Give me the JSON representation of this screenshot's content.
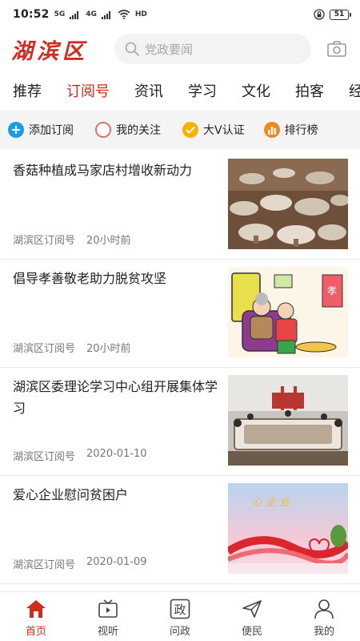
{
  "status_bar": {
    "time": "10:52",
    "signal_1": "5G",
    "signal_2": "4G",
    "network": "HD",
    "battery": "51"
  },
  "header": {
    "logo": "湖滨区",
    "search_placeholder": "党政要闻"
  },
  "tabs": [
    "推荐",
    "订阅号",
    "资讯",
    "学习",
    "文化",
    "拍客",
    "经济"
  ],
  "active_tab": "订阅号",
  "quick_entries": [
    {
      "label": "添加订阅",
      "icon": "plus-icon",
      "color": "#1e9be0"
    },
    {
      "label": "我的关注",
      "icon": "circle-icon",
      "color": "#e8706b"
    },
    {
      "label": "大V认证",
      "icon": "check-badge-icon",
      "color": "#f5b400"
    },
    {
      "label": "排行榜",
      "icon": "bar-chart-icon",
      "color": "#f08a1c"
    }
  ],
  "news": [
    {
      "title": "香菇种植成马家店村增收新动力",
      "source": "湖滨区订阅号",
      "time": "20小时前",
      "image": "mushroom-photo"
    },
    {
      "title": "倡导孝善敬老助力脱贫攻坚",
      "source": "湖滨区订阅号",
      "time": "20小时前",
      "image": "filial-piety-illustration"
    },
    {
      "title": "湖滨区委理论学习中心组开展集体学习",
      "source": "湖滨区订阅号",
      "time": "2020-01-10",
      "image": "meeting-photo"
    },
    {
      "title": "爱心企业慰问贫困户",
      "source": "湖滨区订阅号",
      "time": "2020-01-09",
      "image": "charity-graphic"
    }
  ],
  "thumb_texts": {
    "poster_word": "孝",
    "charity_word": "心 企 业"
  },
  "bottom_nav": [
    {
      "label": "首页",
      "icon": "home-icon"
    },
    {
      "label": "视听",
      "icon": "tv-icon"
    },
    {
      "label": "问政",
      "icon": "zheng-icon",
      "glyph": "政"
    },
    {
      "label": "便民",
      "icon": "send-icon"
    },
    {
      "label": "我的",
      "icon": "user-icon"
    }
  ],
  "colors": {
    "accent": "#d32a1f",
    "quick_bar_bg": "#f4f4f4"
  }
}
